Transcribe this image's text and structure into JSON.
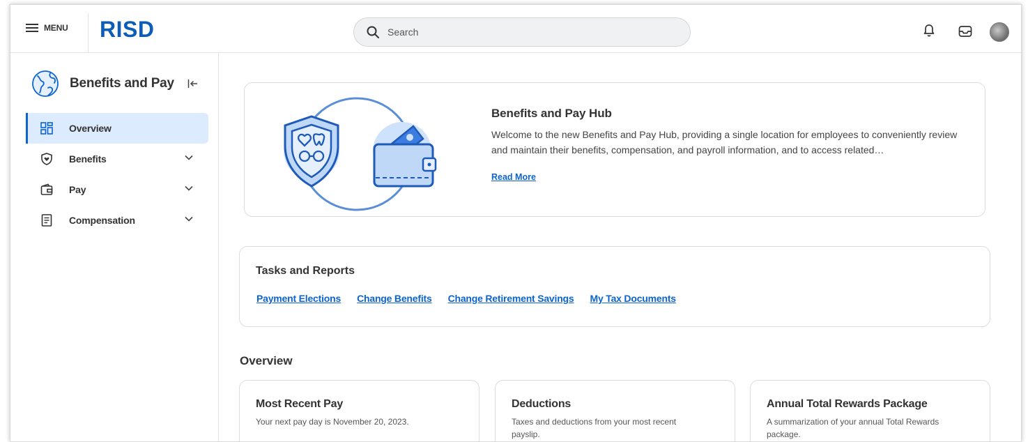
{
  "header": {
    "menu_label": "MENU",
    "logo_text": "RISD",
    "search_placeholder": "Search"
  },
  "sidebar": {
    "title": "Benefits and Pay",
    "items": [
      {
        "label": "Overview",
        "icon": "dashboard-icon",
        "active": true
      },
      {
        "label": "Benefits",
        "icon": "shield-icon",
        "expandable": true
      },
      {
        "label": "Pay",
        "icon": "wallet-icon",
        "expandable": true
      },
      {
        "label": "Compensation",
        "icon": "document-icon",
        "expandable": true
      }
    ]
  },
  "hub": {
    "title": "Benefits and Pay Hub",
    "description": "Welcome to the new Benefits and Pay Hub, providing a single location for employees to conveniently review and maintain their benefits, compensation, and payroll information, and to access related…",
    "read_more": "Read More"
  },
  "tasks": {
    "title": "Tasks and Reports",
    "links": [
      "Payment Elections",
      "Change Benefits",
      "Change Retirement Savings",
      "My Tax Documents"
    ]
  },
  "overview": {
    "title": "Overview",
    "cards": [
      {
        "title": "Most Recent Pay",
        "desc": "Your next pay day is November 20, 2023."
      },
      {
        "title": "Deductions",
        "desc": "Taxes and deductions from your most recent payslip."
      },
      {
        "title": "Annual Total Rewards Package",
        "desc": "A summarization of your annual Total Rewards package."
      }
    ]
  },
  "colors": {
    "brand": "#0d5db8",
    "link": "#0b64d0",
    "active_bg": "#dcebfd"
  }
}
